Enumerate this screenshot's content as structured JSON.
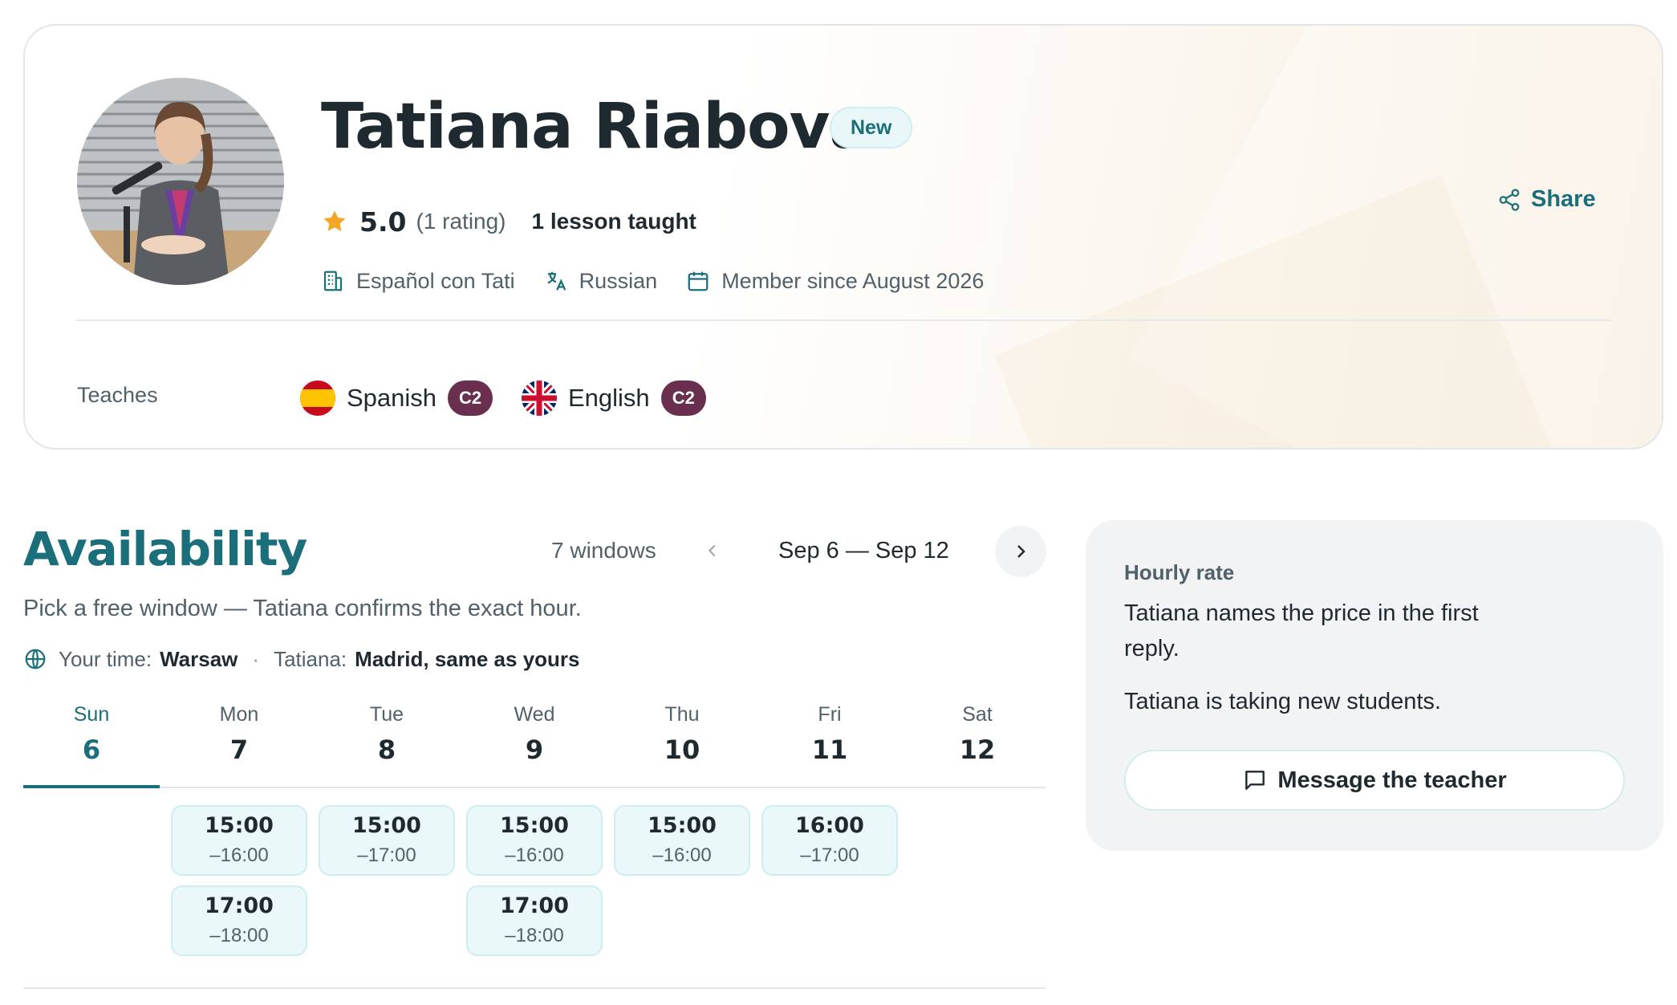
{
  "profile": {
    "name": "Tatiana Riabova",
    "badge": "New",
    "rating": {
      "value": "5.0",
      "count": "(1 rating)",
      "stars": 5.0
    },
    "lessons": "1 lesson taught",
    "school": "Español con Tati",
    "language": "Russian",
    "member_since": "Member since August 2026",
    "share_label": "Share",
    "teaches_label": "Teaches",
    "teaches": [
      {
        "name": "Spanish",
        "level": "C2",
        "flag": "spain-flag-icon"
      },
      {
        "name": "English",
        "level": "C2",
        "flag": "uk-flag-icon"
      }
    ]
  },
  "availability": {
    "title": "Availability",
    "windows": "7 windows",
    "range": "Sep 6 — Sep 12",
    "subtitle": "Pick a free window — Tatiana confirms the exact hour.",
    "your_time_label": "Your time:",
    "your_time_value": "Warsaw",
    "separator": "·",
    "teacher_time_label": "Tatiana:",
    "teacher_time_value": "Madrid, same as yours",
    "days": [
      {
        "name": "Sun",
        "num": "6",
        "active": true
      },
      {
        "name": "Mon",
        "num": "7"
      },
      {
        "name": "Tue",
        "num": "8"
      },
      {
        "name": "Wed",
        "num": "9"
      },
      {
        "name": "Thu",
        "num": "10"
      },
      {
        "name": "Fri",
        "num": "11"
      },
      {
        "name": "Sat",
        "num": "12"
      }
    ],
    "slots": [
      {
        "start": "15:00",
        "end": "–16:00"
      },
      {
        "start": "17:00",
        "end": "–18:00"
      },
      {
        "start": "15:00",
        "end": "–17:00"
      },
      {
        "start": "15:00",
        "end": "–16:00"
      },
      {
        "start": "17:00",
        "end": "–18:00"
      },
      {
        "start": "15:00",
        "end": "–16:00"
      },
      {
        "start": "16:00",
        "end": "–17:00"
      }
    ]
  },
  "rate": {
    "label": "Hourly rate",
    "text": "Tatiana names the price in the first reply.",
    "status": "Tatiana is taking new students.",
    "button": "Message the teacher"
  },
  "colors": {
    "accent": "#1a6f7a",
    "level_badge": "#6a2f4f",
    "slot_bg": "#eaf8f9",
    "star": "#f5a623"
  }
}
